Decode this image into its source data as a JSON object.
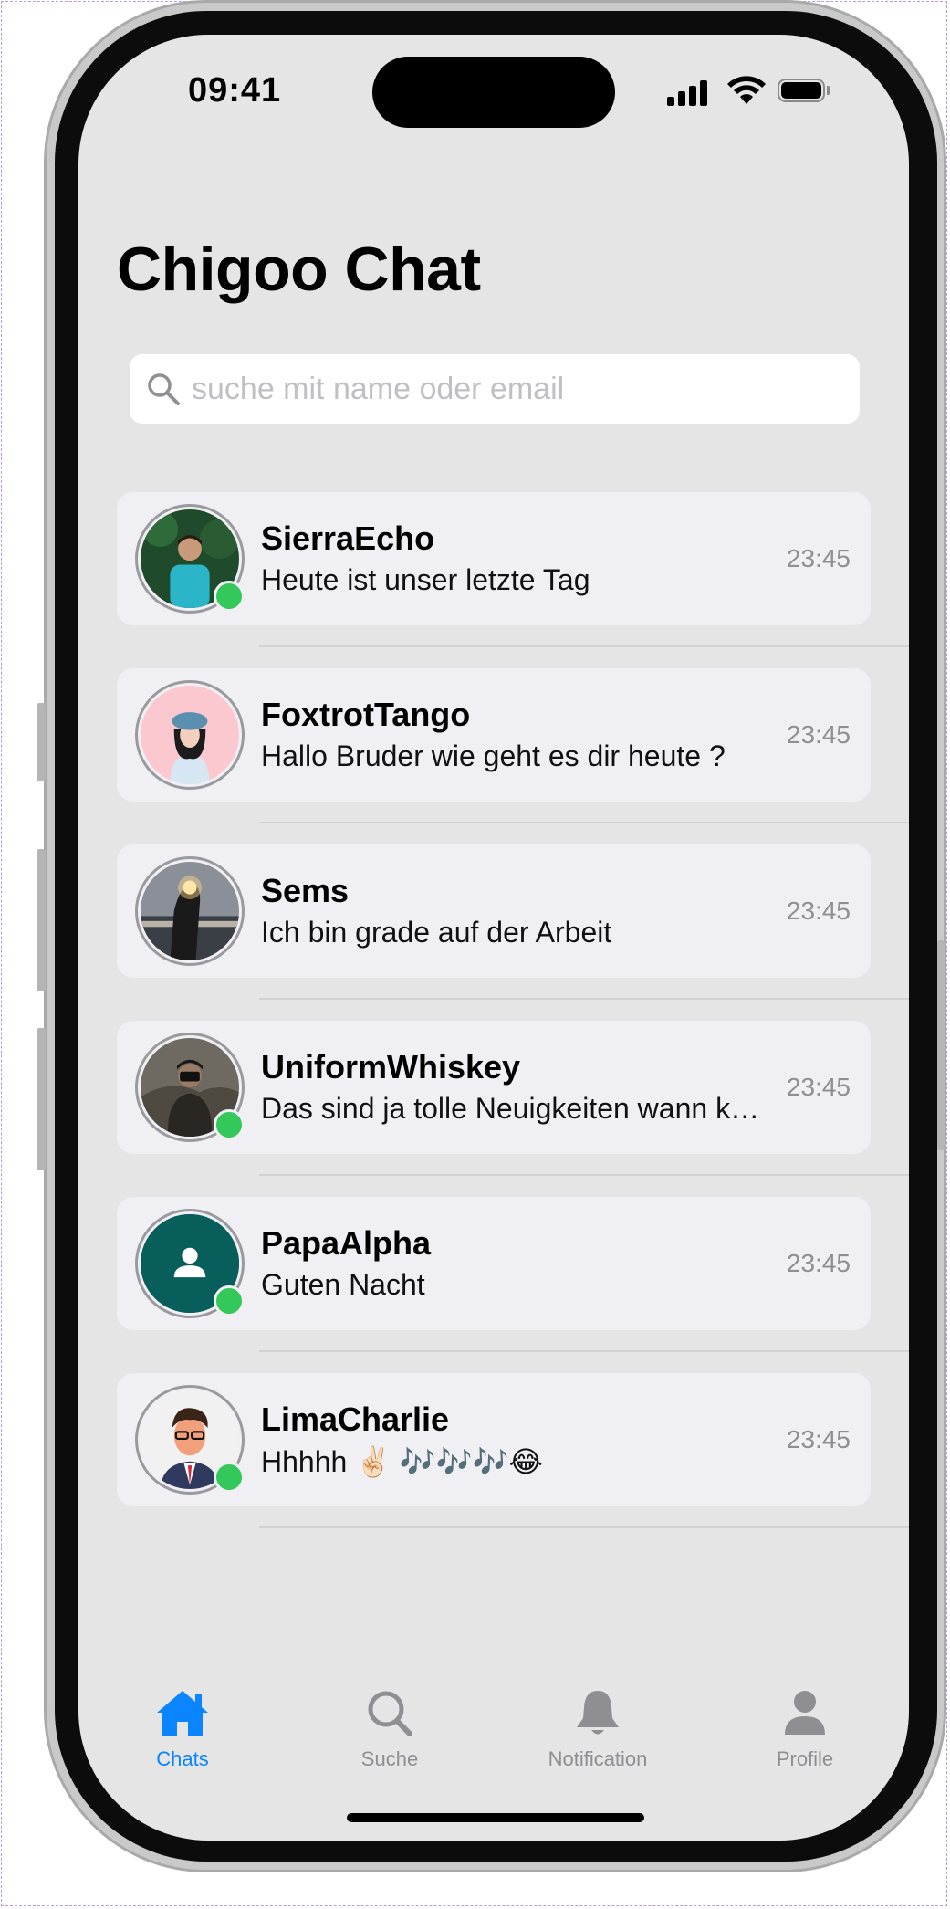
{
  "status_bar": {
    "time": "09:41"
  },
  "header": {
    "title": "Chigoo Chat"
  },
  "search": {
    "placeholder": "suche mit name oder email",
    "value": ""
  },
  "chats": [
    {
      "name": "SierraEcho",
      "message": "Heute ist unser letzte Tag",
      "time": "23:45",
      "online": true
    },
    {
      "name": "FoxtrotTango",
      "message": "Hallo Bruder wie geht es dir heute ?",
      "time": "23:45",
      "online": false
    },
    {
      "name": "Sems",
      "message": "Ich bin grade auf der Arbeit",
      "time": "23:45",
      "online": false
    },
    {
      "name": "UniformWhiskey",
      "message": "Das sind ja tolle Neuigkeiten wann kommst du?",
      "time": "23:45",
      "online": true
    },
    {
      "name": "PapaAlpha",
      "message": "Guten Nacht",
      "time": "23:45",
      "online": true
    },
    {
      "name": "LimaCharlie",
      "message": "Hhhhh ✌🏻 🎶🎶🎶😂",
      "time": "23:45",
      "online": true
    }
  ],
  "tabbar": {
    "items": [
      {
        "label": "Chats",
        "icon": "house-icon",
        "active": true
      },
      {
        "label": "Suche",
        "icon": "search-icon",
        "active": false
      },
      {
        "label": "Notification",
        "icon": "bell-icon",
        "active": false
      },
      {
        "label": "Profile",
        "icon": "person-icon",
        "active": false
      }
    ]
  },
  "colors": {
    "accent": "#0a84ff",
    "online": "#34c759",
    "screen_bg": "#e5e5e5",
    "card_bg": "#efeff4"
  }
}
